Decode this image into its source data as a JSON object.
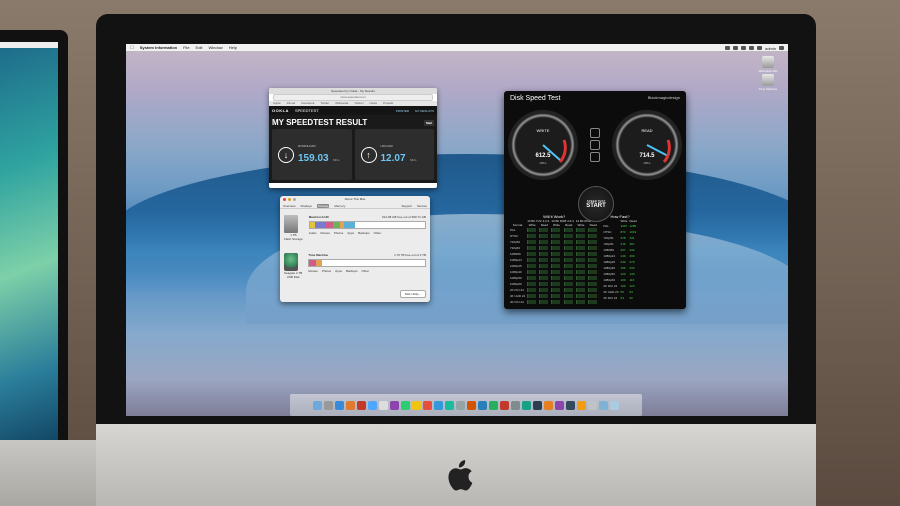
{
  "menubar": {
    "app_name": "System Information",
    "items": [
      "File",
      "Edit",
      "Window",
      "Help"
    ],
    "user_label": "admin"
  },
  "desktop_icons": [
    {
      "label": "Macintosh HD"
    },
    {
      "label": "Time Machine"
    }
  ],
  "speedtest": {
    "window_title": "Speedtest by Ookla - My Results",
    "url": "www.speedtest.net",
    "bookmarks": [
      "Apple",
      "iCloud",
      "Facebook",
      "Twitter",
      "Wikipedia",
      "Yahoo!",
      "News",
      "Popular"
    ],
    "logo": "OOKLA",
    "brand": "SPEEDTEST",
    "nav_links": [
      "PRINTER",
      "MY RESULTS"
    ],
    "headline": "MY SPEEDTEST RESULT",
    "mail_label": "Mail",
    "download_label": "DOWNLOAD",
    "download_value": "159.03",
    "download_unit": "Mb/s",
    "upload_label": "UPLOAD",
    "upload_value": "12.07",
    "upload_unit": "Mb/s"
  },
  "about_mac": {
    "window_title": "About This Mac",
    "tabs": [
      "Overview",
      "Displays",
      "Storage",
      "Memory",
      "Support",
      "Service"
    ],
    "active_tab": "Storage",
    "disk1_name": "Macintosh HD",
    "disk1_sub": "1 TB\nFlash Storage",
    "disk1_free": "612.98 GB free out of 999.71 GB",
    "disk1_legend": [
      "Audio",
      "Movies",
      "Photos",
      "Apps",
      "Backups",
      "Other"
    ],
    "disk1_segments": [
      {
        "color": "#e4c43f",
        "fraction": 0.05
      },
      {
        "color": "#7a7ad0",
        "fraction": 0.08
      },
      {
        "color": "#d35b8a",
        "fraction": 0.07
      },
      {
        "color": "#6cb25a",
        "fraction": 0.06
      },
      {
        "color": "#e3a34e",
        "fraction": 0.04
      },
      {
        "color": "#5bb0d8",
        "fraction": 0.09
      }
    ],
    "disk2_name": "Time Machine",
    "disk2_sub": "Seagate 2 TB\nUSB Disk",
    "disk2_free": "1.76 TB free out of 2 TB",
    "disk2_legend": [
      "Movies",
      "Photos",
      "Apps",
      "Backups",
      "Other"
    ],
    "disk2_segments": [
      {
        "color": "#d35b8a",
        "fraction": 0.06
      },
      {
        "color": "#e3a34e",
        "fraction": 0.05
      }
    ],
    "button": "Disk Utility..."
  },
  "disk_speed_test": {
    "title": "Disk Speed Test",
    "brand": "Blackmagicdesign",
    "write_label": "WRITE",
    "write_value": "612.5",
    "write_unit": "MB/s",
    "read_label": "READ",
    "read_value": "714.5",
    "read_unit": "MB/s",
    "start_sub": "SPEED TEST",
    "start_label": "START",
    "will_it_work": "Will it Work?",
    "how_fast": "How Fast?",
    "col_headers": [
      "10 Bit YUV 4:2:2",
      "10 Bit RGB 4:4:4",
      "12 Bit RGB 4:4:4"
    ],
    "sub_headers": [
      "Format",
      "Write",
      "Read",
      "Write",
      "Read",
      "Write",
      "Read"
    ],
    "formats": [
      "PAL",
      "NTSC",
      "720p50",
      "720p60",
      "1080i50",
      "1080p24",
      "1080p25",
      "1080p30",
      "1080p50",
      "1080p60",
      "2K DCI 24",
      "4K UHD 24",
      "4K DCI 24"
    ],
    "fps_write": [
      "1097",
      "873",
      "378",
      "315",
      "207",
      "249",
      "239",
      "199",
      "120",
      "100",
      "106",
      "55",
      "53"
    ],
    "fps_read": [
      "1280",
      "1019",
      "441",
      "367",
      "242",
      "290",
      "279",
      "232",
      "140",
      "116",
      "123",
      "64",
      "62"
    ]
  },
  "dock": {
    "icon_colors": [
      "#6fa8dc",
      "#999999",
      "#3b8ad9",
      "#e07a2f",
      "#c0392b",
      "#4da6ff",
      "#dddddd",
      "#8e44ad",
      "#2ecc71",
      "#f1c40f",
      "#e74c3c",
      "#3498db",
      "#1abc9c",
      "#95a5a6",
      "#d35400",
      "#2980b9",
      "#27ae60",
      "#c0392b",
      "#7f8c8d",
      "#16a085",
      "#2c3e50",
      "#e67e22",
      "#8e44ad",
      "#34495e",
      "#f39c12",
      "#bdc3c7",
      "#7fb3d5",
      "#a9cce3"
    ]
  }
}
